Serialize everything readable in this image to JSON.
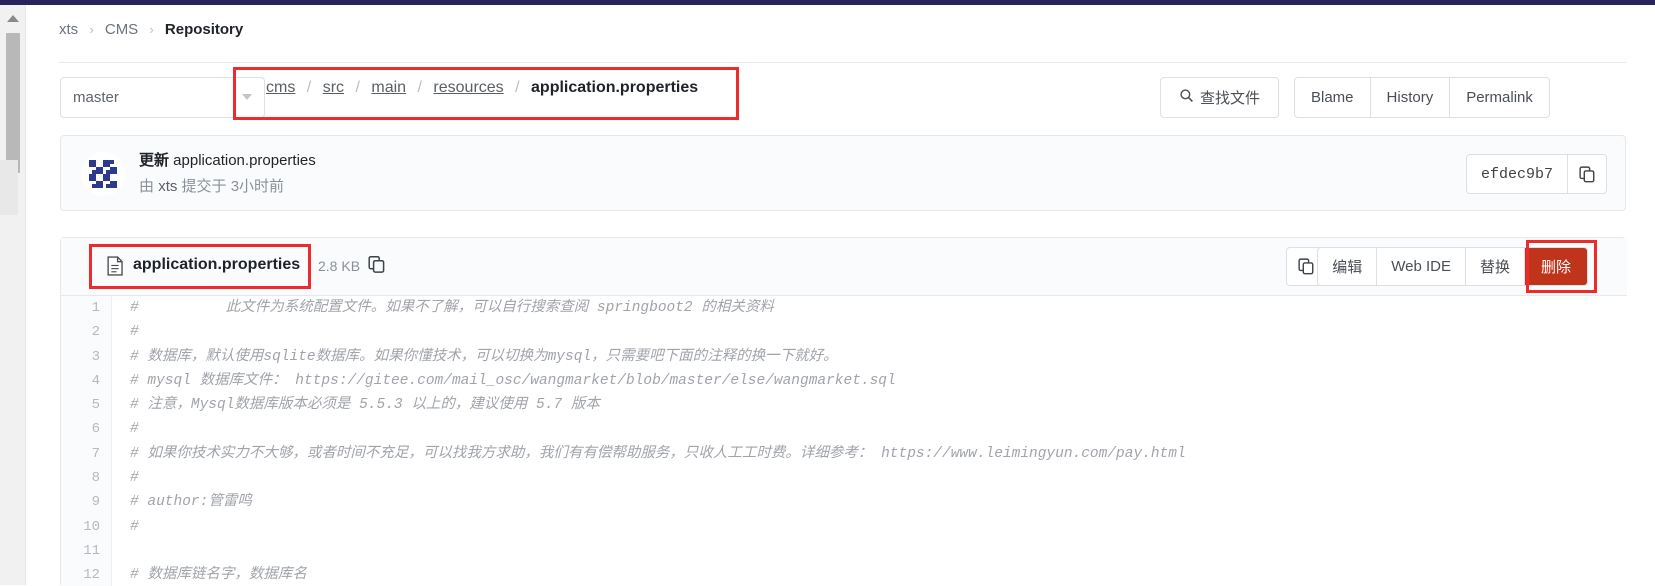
{
  "breadcrumb": {
    "items": [
      "xts",
      "CMS",
      "Repository"
    ],
    "separator": "›"
  },
  "toolbar": {
    "branch": "master",
    "branch_caret_icon": "chevron-down-icon",
    "path_segments": [
      "cms",
      "src",
      "main",
      "resources"
    ],
    "path_file": "application.properties",
    "path_separator": "/",
    "find_file_label": "查找文件",
    "find_icon": "search-icon",
    "blame_label": "Blame",
    "history_label": "History",
    "permalink_label": "Permalink",
    "highlight_color": "#ec2b2b"
  },
  "commit": {
    "message_bold": "更新",
    "message_rest": " application.properties",
    "by_prefix": "由",
    "author": "xts",
    "by_suffix": "提交于",
    "time": "3小时前",
    "hash": "efdec9b7",
    "copy_icon": "copy-icon",
    "avatar": "identicon-avatar"
  },
  "file": {
    "doc_icon": "file-document-icon",
    "name": "application.properties",
    "size": "2.8 KB",
    "copy_path_icon": "copy-icon",
    "icon_buttons": [
      {
        "name": "copy-content-icon",
        "glyph": "copy"
      },
      {
        "name": "raw-file-icon",
        "glyph": "raw"
      },
      {
        "name": "download-icon",
        "glyph": "download"
      }
    ],
    "actions": [
      {
        "label": "编辑",
        "name": "edit-button",
        "danger": false
      },
      {
        "label": "Web IDE",
        "name": "web-ide-button",
        "danger": false
      },
      {
        "label": "替换",
        "name": "replace-button",
        "danger": false
      },
      {
        "label": "删除",
        "name": "delete-button",
        "danger": true
      }
    ],
    "danger_color": "#c0341b"
  },
  "code": {
    "line_numbers": [
      "1",
      "2",
      "3",
      "4",
      "5",
      "6",
      "7",
      "8",
      "9",
      "10",
      "11",
      "12"
    ],
    "lines": [
      "#          此文件为系统配置文件。如果不了解，可以自行搜索查阅 springboot2 的相关资料",
      "#",
      "# 数据库，默认使用sqlite数据库。如果你懂技术，可以切换为mysql，只需要吧下面的注释的换一下就好。",
      "# mysql 数据库文件： https://gitee.com/mail_osc/wangmarket/blob/master/else/wangmarket.sql",
      "# 注意，Mysql数据库版本必须是 5.5.3 以上的，建议使用 5.7 版本",
      "#",
      "# 如果你技术实力不大够，或者时间不充足，可以找我方求助，我们有有偿帮助服务，只收人工工时费。详细参考： https://www.leimingyun.com/pay.html",
      "#",
      "# author:管雷鸣",
      "#",
      "",
      "# 数据库链名字，数据库名"
    ]
  }
}
